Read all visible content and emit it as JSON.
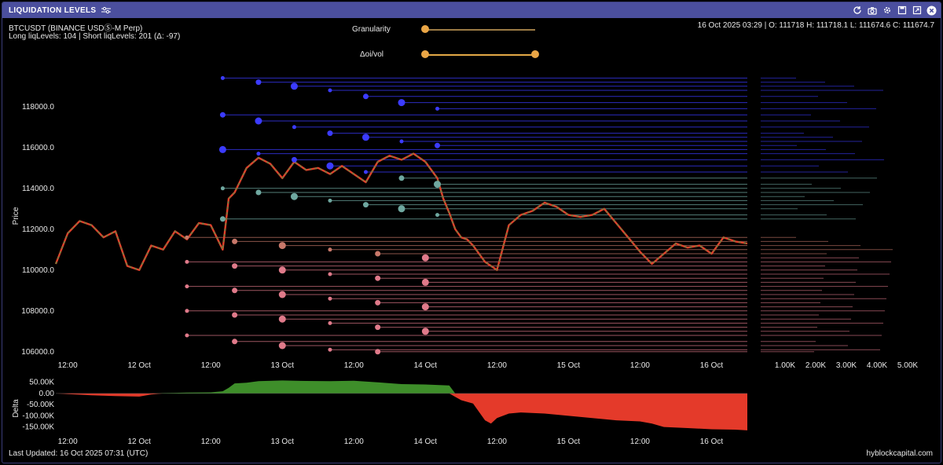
{
  "window": {
    "title": "LIQUIDATION LEVELS",
    "icons": [
      "refresh-icon",
      "camera-icon",
      "gear-icon",
      "save-icon",
      "expand-icon",
      "close-icon"
    ]
  },
  "header": {
    "symbol": "BTCUSDT (BINANCE USDⓈ-M Perp)",
    "levels": "Long liqLevels: 104 | Short liqLevels: 201 (Δ: -97)",
    "ohlc": "16 Oct 2025 03:29 | O: 111718 H: 111718.1 L: 111674.6 C: 111674.7"
  },
  "controls": {
    "granularity": {
      "label": "Granularity",
      "value": 0
    },
    "oivol": {
      "label": "Δoi/vol",
      "range": [
        0,
        1
      ]
    }
  },
  "footer": {
    "last_updated": "Last Updated: 16 Oct 2025 07:31 (UTC)",
    "brand": "hyblockcapital.com"
  },
  "colors": {
    "short_levels": "#3b3bff",
    "mid_levels": "#6fa8a0",
    "long_levels": "#e07a8a",
    "delta_positive": "#3e8e2a",
    "delta_negative": "#e43a2a",
    "candle_up": "#3aa04a",
    "candle_down": "#e0402a",
    "titlebar": "#4b4f9e"
  },
  "chart_data": [
    {
      "type": "line",
      "ylabel": "Price",
      "ylim": [
        105800,
        119800
      ],
      "y_ticks": [
        106000,
        108000,
        110000,
        112000,
        114000,
        116000,
        118000
      ],
      "y_tick_labels": [
        "106000.0",
        "108000.0",
        "110000.0",
        "112000.0",
        "114000.0",
        "116000.0",
        "118000.0"
      ],
      "x_tick_labels": [
        "12:00",
        "12 Oct",
        "12:00",
        "13 Oct",
        "12:00",
        "14 Oct",
        "12:00",
        "15 Oct",
        "12:00",
        "16 Oct"
      ],
      "xlim_hours": [
        0,
        114
      ],
      "x_ticks_hours": [
        0,
        12,
        24,
        36,
        48,
        60,
        72,
        84,
        96,
        108
      ],
      "price_series": {
        "name": "BTCUSDT",
        "x_hours": [
          -2,
          0,
          2,
          4,
          6,
          8,
          10,
          12,
          14,
          16,
          18,
          20,
          22,
          24,
          26,
          27,
          28,
          30,
          32,
          34,
          36,
          38,
          40,
          42,
          44,
          46,
          48,
          50,
          52,
          54,
          56,
          58,
          60,
          62,
          63,
          64,
          65,
          66,
          67,
          68,
          70,
          72,
          74,
          76,
          78,
          80,
          82,
          84,
          86,
          88,
          90,
          92,
          94,
          96,
          98,
          100,
          102,
          104,
          106,
          108,
          110,
          112,
          114
        ],
        "y": [
          110300,
          111800,
          112400,
          112200,
          111600,
          111900,
          110200,
          110000,
          111200,
          111000,
          111900,
          111500,
          112300,
          112200,
          111000,
          113500,
          113800,
          115000,
          115500,
          115200,
          114500,
          115300,
          114900,
          115000,
          114700,
          115100,
          114700,
          114300,
          115300,
          115600,
          115400,
          115700,
          115300,
          114500,
          113500,
          112800,
          112000,
          111600,
          111500,
          111200,
          110400,
          110000,
          112200,
          112700,
          112900,
          113300,
          113100,
          112700,
          112600,
          112700,
          113000,
          112300,
          111600,
          110900,
          110300,
          110800,
          111300,
          111100,
          111200,
          110800,
          111600,
          111400,
          111300
        ]
      },
      "short_liq_levels": [
        119400,
        119200,
        119000,
        118800,
        118500,
        118200,
        117900,
        117600,
        117300,
        117000,
        116700,
        116500,
        116300,
        116100,
        115900,
        115700,
        115400,
        115100,
        114800,
        114500,
        114200,
        114000,
        113800,
        113600,
        113400,
        113200,
        113000,
        112700,
        112500
      ],
      "long_liq_levels": [
        111600,
        111400,
        111200,
        111000,
        110800,
        110600,
        110400,
        110200,
        110000,
        109800,
        109600,
        109400,
        109200,
        109000,
        108800,
        108600,
        108400,
        108200,
        108000,
        107800,
        107600,
        107400,
        107200,
        107000,
        106800,
        106500,
        106300,
        106100,
        106000
      ]
    },
    {
      "type": "bar",
      "xlabel": "",
      "ylabel": "",
      "xlim": [
        0,
        5000
      ],
      "x_ticks": [
        1000,
        2000,
        3000,
        4000,
        5000
      ],
      "x_tick_labels": [
        "1.00K",
        "2.00K",
        "3.00K",
        "4.00K",
        "5.00K"
      ]
    },
    {
      "type": "area",
      "ylabel": "Delta",
      "ylim": [
        -190000,
        70000
      ],
      "y_ticks": [
        50000,
        0,
        -50000,
        -100000,
        -150000
      ],
      "y_tick_labels": [
        "50.00K",
        "0.00",
        "-50.00K",
        "-100.00K",
        "-150.00K"
      ],
      "x_tick_labels": [
        "12:00",
        "12 Oct",
        "12:00",
        "13 Oct",
        "12:00",
        "14 Oct",
        "12:00",
        "15 Oct",
        "12:00",
        "16 Oct"
      ],
      "x_hours": [
        -2,
        0,
        4,
        8,
        12,
        14,
        16,
        18,
        20,
        24,
        26,
        27,
        28,
        30,
        32,
        36,
        40,
        44,
        48,
        52,
        56,
        60,
        64,
        65,
        66,
        68,
        70,
        71,
        72,
        74,
        76,
        80,
        84,
        88,
        92,
        96,
        98,
        100,
        104,
        108,
        112,
        114
      ],
      "y": [
        0,
        -3000,
        -8000,
        -12000,
        -14000,
        -5000,
        2000,
        3000,
        4000,
        5000,
        10000,
        25000,
        45000,
        48000,
        55000,
        58000,
        56000,
        55000,
        57000,
        50000,
        42000,
        40000,
        36000,
        -15000,
        -30000,
        -45000,
        -120000,
        -135000,
        -110000,
        -90000,
        -85000,
        -90000,
        -100000,
        -110000,
        -120000,
        -125000,
        -135000,
        -150000,
        -155000,
        -160000,
        -162000,
        -165000
      ]
    }
  ]
}
